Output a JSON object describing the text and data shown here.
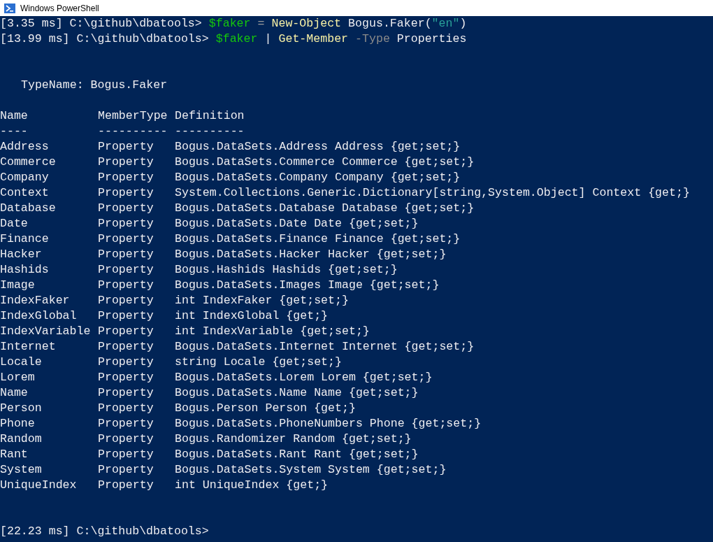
{
  "window": {
    "title": "Windows PowerShell"
  },
  "commands": [
    {
      "segments": [
        {
          "kind": "prompt",
          "text": "[3.35 ms] C:\\github\\dbatools>"
        },
        {
          "kind": "variable",
          "text": "$faker"
        },
        {
          "kind": "operator",
          "text": "="
        },
        {
          "kind": "command",
          "text": "New-Object"
        },
        {
          "kind": "argument",
          "text": "Bogus.Faker("
        },
        {
          "kind": "string",
          "text": "\"en\""
        },
        {
          "kind": "argument",
          "text": ")"
        }
      ]
    },
    {
      "segments": [
        {
          "kind": "prompt",
          "text": "[13.99 ms] C:\\github\\dbatools>"
        },
        {
          "kind": "variable",
          "text": "$faker"
        },
        {
          "kind": "pipe",
          "text": "|"
        },
        {
          "kind": "command",
          "text": "Get-Member"
        },
        {
          "kind": "parameter",
          "text": "-Type"
        },
        {
          "kind": "argument",
          "text": "Properties"
        }
      ]
    }
  ],
  "output": {
    "type_name": "TypeName: Bogus.Faker",
    "columns": [
      "Name",
      "MemberType",
      "Definition"
    ],
    "underlines": [
      "----",
      "----------",
      "----------"
    ],
    "rows": [
      {
        "name": "Address",
        "member_type": "Property",
        "definition": "Bogus.DataSets.Address Address {get;set;}"
      },
      {
        "name": "Commerce",
        "member_type": "Property",
        "definition": "Bogus.DataSets.Commerce Commerce {get;set;}"
      },
      {
        "name": "Company",
        "member_type": "Property",
        "definition": "Bogus.DataSets.Company Company {get;set;}"
      },
      {
        "name": "Context",
        "member_type": "Property",
        "definition": "System.Collections.Generic.Dictionary[string,System.Object] Context {get;}"
      },
      {
        "name": "Database",
        "member_type": "Property",
        "definition": "Bogus.DataSets.Database Database {get;set;}"
      },
      {
        "name": "Date",
        "member_type": "Property",
        "definition": "Bogus.DataSets.Date Date {get;set;}"
      },
      {
        "name": "Finance",
        "member_type": "Property",
        "definition": "Bogus.DataSets.Finance Finance {get;set;}"
      },
      {
        "name": "Hacker",
        "member_type": "Property",
        "definition": "Bogus.DataSets.Hacker Hacker {get;set;}"
      },
      {
        "name": "Hashids",
        "member_type": "Property",
        "definition": "Bogus.Hashids Hashids {get;set;}"
      },
      {
        "name": "Image",
        "member_type": "Property",
        "definition": "Bogus.DataSets.Images Image {get;set;}"
      },
      {
        "name": "IndexFaker",
        "member_type": "Property",
        "definition": "int IndexFaker {get;set;}"
      },
      {
        "name": "IndexGlobal",
        "member_type": "Property",
        "definition": "int IndexGlobal {get;}"
      },
      {
        "name": "IndexVariable",
        "member_type": "Property",
        "definition": "int IndexVariable {get;set;}"
      },
      {
        "name": "Internet",
        "member_type": "Property",
        "definition": "Bogus.DataSets.Internet Internet {get;set;}"
      },
      {
        "name": "Locale",
        "member_type": "Property",
        "definition": "string Locale {get;set;}"
      },
      {
        "name": "Lorem",
        "member_type": "Property",
        "definition": "Bogus.DataSets.Lorem Lorem {get;set;}"
      },
      {
        "name": "Name",
        "member_type": "Property",
        "definition": "Bogus.DataSets.Name Name {get;set;}"
      },
      {
        "name": "Person",
        "member_type": "Property",
        "definition": "Bogus.Person Person {get;}"
      },
      {
        "name": "Phone",
        "member_type": "Property",
        "definition": "Bogus.DataSets.PhoneNumbers Phone {get;set;}"
      },
      {
        "name": "Random",
        "member_type": "Property",
        "definition": "Bogus.Randomizer Random {get;set;}"
      },
      {
        "name": "Rant",
        "member_type": "Property",
        "definition": "Bogus.DataSets.Rant Rant {get;set;}"
      },
      {
        "name": "System",
        "member_type": "Property",
        "definition": "Bogus.DataSets.System System {get;set;}"
      },
      {
        "name": "UniqueIndex",
        "member_type": "Property",
        "definition": "int UniqueIndex {get;}"
      }
    ]
  },
  "final_prompt": "[22.23 ms] C:\\github\\dbatools>"
}
